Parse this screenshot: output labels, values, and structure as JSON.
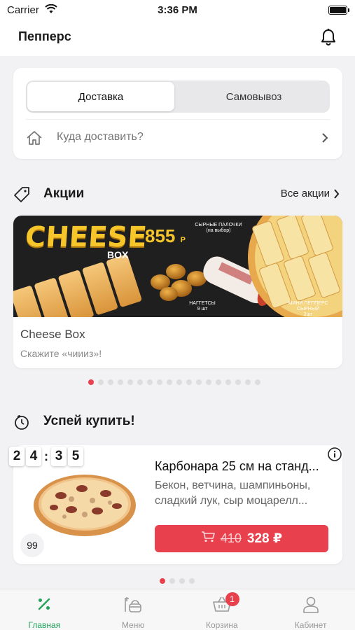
{
  "status_bar": {
    "carrier": "Carrier",
    "time": "3:36 PM"
  },
  "header": {
    "title": "Пепперс"
  },
  "delivery": {
    "tabs": [
      {
        "label": "Доставка",
        "selected": true
      },
      {
        "label": "Самовывоз",
        "selected": false
      }
    ],
    "address_placeholder": "Куда доставить?"
  },
  "promos": {
    "title": "Акции",
    "all_link": "Все акции",
    "card": {
      "title": "Cheese Box",
      "subtitle": "Скажите «чиииз»!",
      "banner": {
        "headline": "CHEESE",
        "sub": "BOX",
        "price": "855",
        "currency": "Р",
        "labels": [
          "СЫРНЫЕ ПАЛОЧКИ\n(на выбор)",
          "НАГГЕТСЫ\n9 шт",
          "МИНИ ПЕППЕРС СЫРНЫЙ\n2шт"
        ]
      }
    },
    "dots_total": 18,
    "dots_active": 0
  },
  "hurry": {
    "title": "Успей купить!",
    "timer": [
      "2",
      "4",
      "3",
      "5"
    ],
    "product": {
      "title": "Карбонара 25 см на станд...",
      "description": "Бекон, ветчина, шампиньоны, сладкий лук, сыр моцарелл...",
      "old_price": "410",
      "new_price": "328 ₽",
      "count": "99"
    },
    "dots_total": 4,
    "dots_active": 0
  },
  "tabbar": {
    "items": [
      {
        "label": "Главная",
        "icon": "percent-icon",
        "active": true
      },
      {
        "label": "Меню",
        "icon": "menu-food-icon",
        "active": false
      },
      {
        "label": "Корзина",
        "icon": "basket-icon",
        "active": false,
        "badge": "1"
      },
      {
        "label": "Кабинет",
        "icon": "user-icon",
        "active": false
      }
    ]
  },
  "colors": {
    "accent": "#e8404c",
    "active_tab": "#24a35a",
    "banner_yellow": "#f6c52a"
  }
}
